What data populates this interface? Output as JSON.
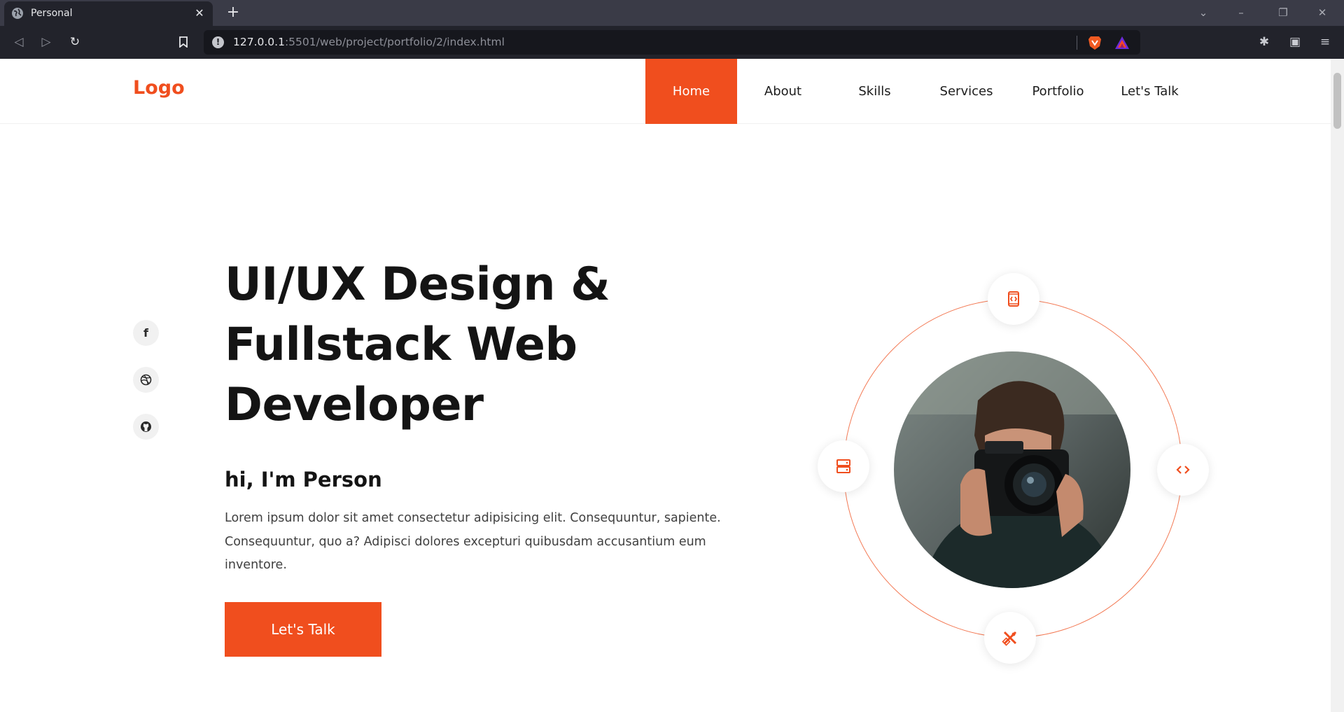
{
  "browser": {
    "tab_title": "Personal",
    "tab_icon": "globe-icon",
    "new_tab_label": "+",
    "url_host": "127.0.0.1",
    "url_rest": ":5501/web/project/portfolio/2/index.html",
    "info_badge": "!"
  },
  "header": {
    "logo": "Logo",
    "menu": [
      {
        "label": "Home",
        "active": true
      },
      {
        "label": "About",
        "active": false
      },
      {
        "label": "Skills",
        "active": false
      },
      {
        "label": "Services",
        "active": false
      },
      {
        "label": "Portfolio",
        "active": false
      },
      {
        "label": "Let's Talk",
        "active": false
      }
    ]
  },
  "socials": [
    {
      "icon": "facebook-icon",
      "glyph": "f"
    },
    {
      "icon": "dribbble-icon"
    },
    {
      "icon": "github-icon"
    }
  ],
  "hero": {
    "title_line1": "UI/UX Design &",
    "title_line2": "Fullstack Web",
    "title_line3": "Developer",
    "subtitle": "hi, I'm Person",
    "description_line1": "Lorem ipsum dolor sit amet consectetur adipisicing elit. Consequuntur, sapiente.",
    "description_line2": "Consequuntur, quo a? Adipisci dolores excepturi quibusdam accusantium eum",
    "description_line3": "inventore.",
    "cta_label": "Let's Talk"
  },
  "orbit_icons": [
    "mobile-code-icon",
    "server-icon",
    "code-brackets-icon",
    "design-tools-icon"
  ],
  "colors": {
    "accent": "#f04e1e",
    "text": "#141414",
    "chrome_bg": "#22232b"
  }
}
